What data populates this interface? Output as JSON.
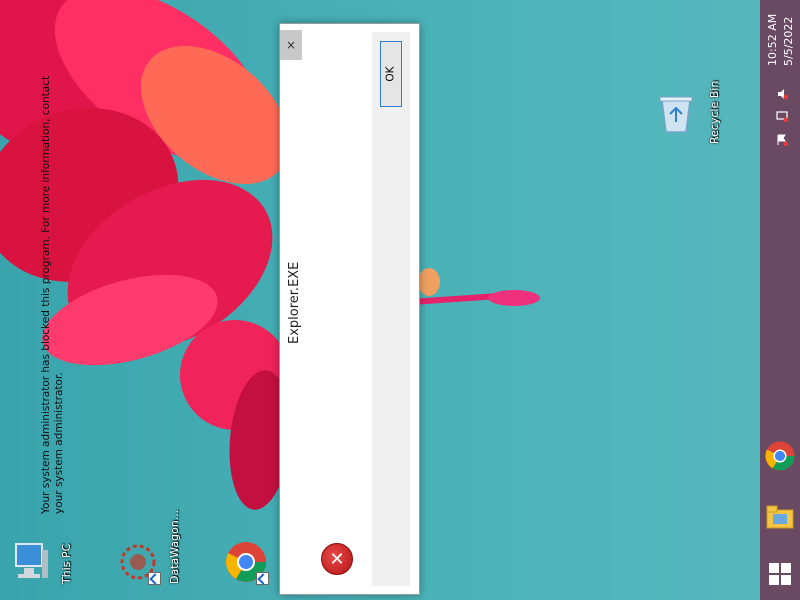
{
  "desktop": {
    "icons": [
      {
        "label": "This PC",
        "icon": "this-pc-icon"
      },
      {
        "label": "DataWagon...",
        "icon": "datawagon-icon"
      },
      {
        "label": "Recycle Bin",
        "icon": "recycle-bin-icon"
      },
      {
        "label": "",
        "icon": "chrome-icon"
      }
    ]
  },
  "dialog": {
    "title": "Explorer.EXE",
    "close_label": "×",
    "message": "Your system administrator has blocked this program. For more information, contact your system administrator.",
    "ok_label": "OK",
    "icon": "error-icon"
  },
  "taskbar": {
    "time": "10:52 AM",
    "date": "5/5/2022",
    "tray_icons": [
      "volume-muted-icon",
      "network-error-icon",
      "action-center-flag-icon"
    ],
    "pinned": [
      "chrome-icon",
      "file-explorer-icon",
      "start-icon"
    ]
  },
  "colors": {
    "taskbar": "#6a4a63",
    "accent": "#2f7fd3",
    "error": "#c0392b"
  }
}
